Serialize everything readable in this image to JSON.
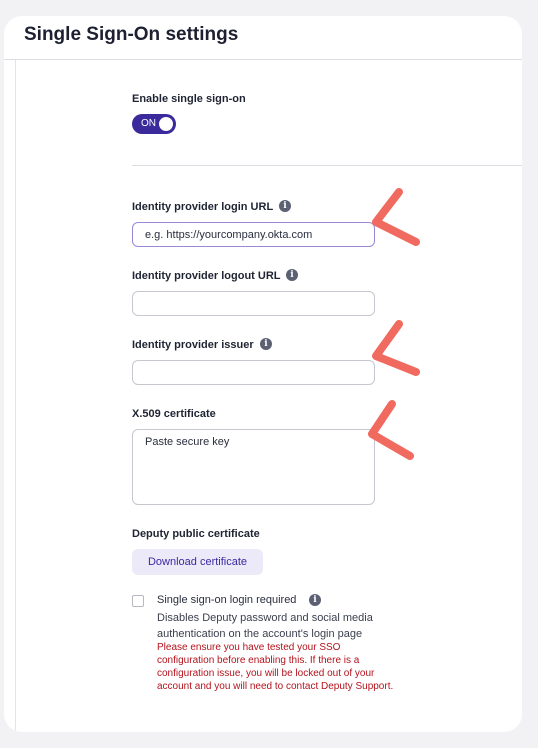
{
  "page": {
    "title": "Single Sign-On settings"
  },
  "sso_toggle": {
    "label": "Enable single sign-on",
    "state": "ON"
  },
  "fields": {
    "login_url": {
      "label": "Identity provider login URL",
      "value": "e.g. https://yourcompany.okta.com"
    },
    "logout_url": {
      "label": "Identity provider logout URL",
      "value": ""
    },
    "issuer": {
      "label": "Identity provider issuer",
      "value": ""
    },
    "certificate": {
      "label": "X.509 certificate",
      "value": "Paste secure key"
    }
  },
  "public_cert": {
    "label": "Deputy public certificate",
    "button_label": "Download certificate"
  },
  "login_required": {
    "label": "Single sign-on login required",
    "description": "Disables Deputy password and social media authentication on the account's login page",
    "warning": "Please ensure you have tested your SSO configuration before enabling this. If there is a configuration issue, you will be locked out of your account and you will need to contact Deputy Support."
  },
  "icons": {
    "info": "info-icon",
    "annotation": "red-arrow-annotation"
  },
  "colors": {
    "accent": "#3b2a9c",
    "warning": "#b3131d",
    "annotation": "#f06a5f"
  }
}
